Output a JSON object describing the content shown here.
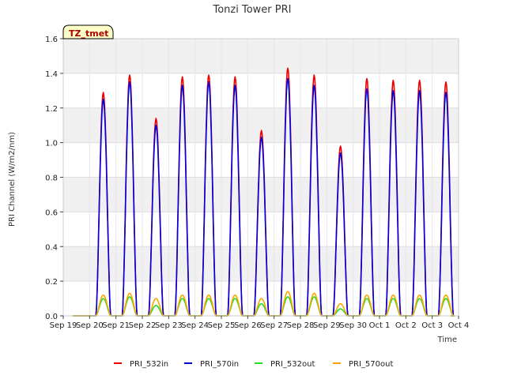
{
  "chart_data": {
    "type": "line",
    "title": "Tonzi Tower PRI",
    "xlabel": "Time",
    "ylabel": "PRI Channel (W/m2/nm)",
    "site_tag": "TZ_tmet",
    "ylim": [
      0.0,
      1.6
    ],
    "yticks": [
      0.0,
      0.2,
      0.4,
      0.6,
      0.8,
      1.0,
      1.2,
      1.4,
      1.6
    ],
    "ytick_labels": [
      "0.0",
      "0.2",
      "0.4",
      "0.6",
      "0.8",
      "1.0",
      "1.2",
      "1.4",
      "1.6"
    ],
    "x_tick_labels": [
      "Sep 19",
      "Sep 20",
      "Sep 21",
      "Sep 22",
      "Sep 23",
      "Sep 24",
      "Sep 25",
      "Sep 26",
      "Sep 27",
      "Sep 28",
      "Sep 29",
      "Sep 30",
      "Oct 1",
      "Oct 2",
      "Oct 3",
      "Oct 4"
    ],
    "xlim_days": [
      0,
      15
    ],
    "grid": true,
    "background_bands": true,
    "legend_position": "bottom",
    "daily_peak_day_offset": [
      0.52,
      0.52,
      0.52,
      0.52,
      0.52,
      0.52,
      0.52,
      0.52,
      0.52,
      0.52,
      0.52,
      0.52,
      0.52,
      0.52
    ],
    "series": [
      {
        "name": "PRI_532in",
        "color": "#ee0000",
        "daily_peaks": [
          1.29,
          1.39,
          1.14,
          1.38,
          1.39,
          1.38,
          1.07,
          1.43,
          1.39,
          0.98,
          1.37,
          1.36,
          1.36,
          1.35
        ]
      },
      {
        "name": "PRI_570in",
        "color": "#0000dd",
        "daily_peaks": [
          1.25,
          1.35,
          1.1,
          1.33,
          1.35,
          1.33,
          1.03,
          1.37,
          1.33,
          0.94,
          1.31,
          1.3,
          1.3,
          1.29
        ]
      },
      {
        "name": "PRI_532out",
        "color": "#22dd22",
        "daily_peaks": [
          0.1,
          0.11,
          0.06,
          0.1,
          0.1,
          0.1,
          0.07,
          0.11,
          0.11,
          0.04,
          0.1,
          0.1,
          0.1,
          0.1
        ]
      },
      {
        "name": "PRI_570out",
        "color": "#ffa500",
        "daily_peaks": [
          0.12,
          0.13,
          0.1,
          0.12,
          0.12,
          0.12,
          0.1,
          0.14,
          0.13,
          0.07,
          0.12,
          0.12,
          0.12,
          0.12
        ]
      }
    ]
  }
}
